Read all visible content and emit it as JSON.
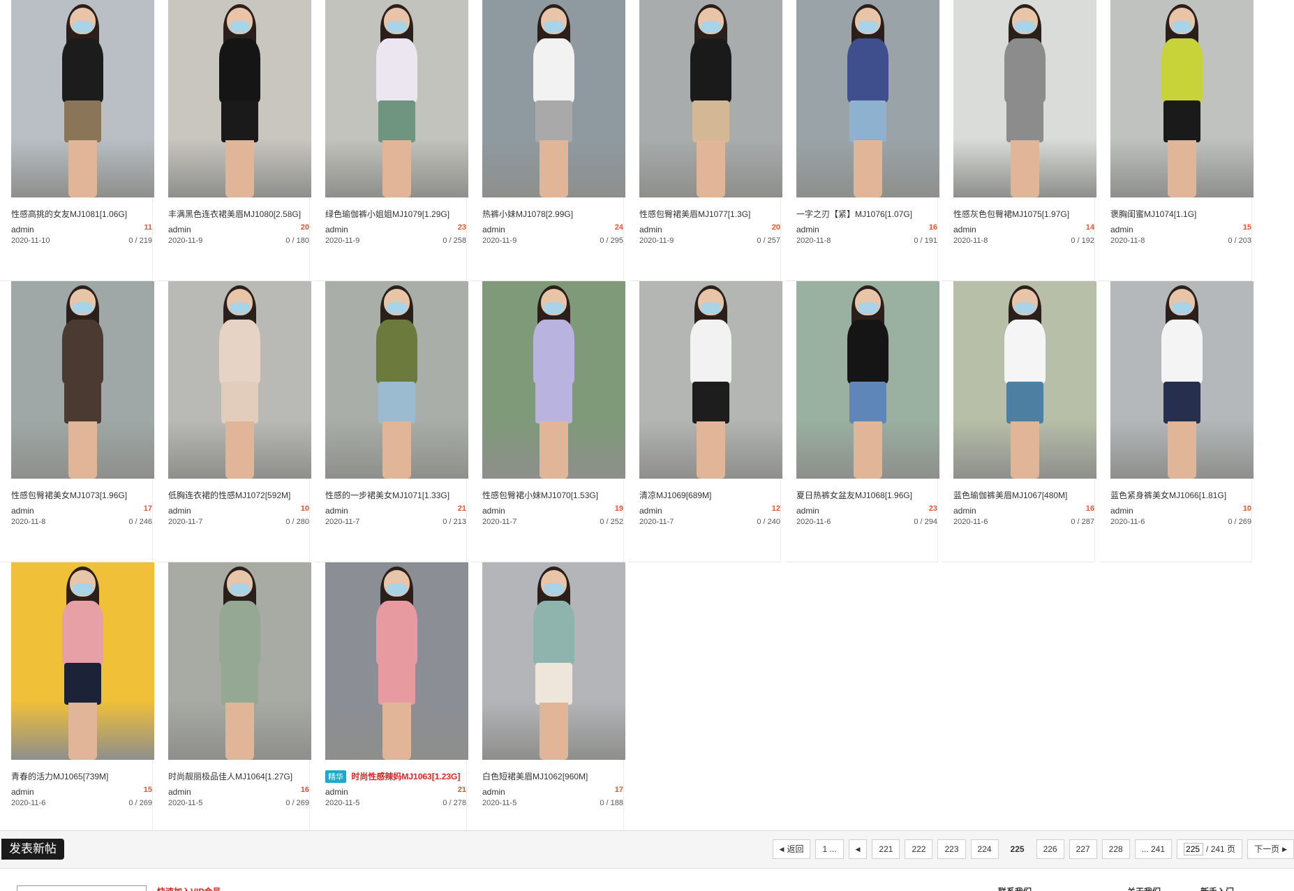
{
  "cards": [
    {
      "title": "性感高挑的女友MJ1081[1.06G]",
      "author": "admin",
      "count": "11",
      "date": "2020-11-10",
      "stats": "0 / 219",
      "bg": "#b9bfc4",
      "top": "#1c1c1c",
      "bottom": "#8a7558"
    },
    {
      "title": "丰满黑色连衣裙美眉MJ1080[2.58G]",
      "author": "admin",
      "count": "20",
      "date": "2020-11-9",
      "stats": "0 / 180",
      "bg": "#c9c6c0",
      "top": "#151515",
      "bottom": "#1a1a1a"
    },
    {
      "title": "绿色瑜伽裤小姐姐MJ1079[1.29G]",
      "author": "admin",
      "count": "23",
      "date": "2020-11-9",
      "stats": "0 / 258",
      "bg": "#c3c3bd",
      "top": "#ece6f0",
      "bottom": "#6f9480"
    },
    {
      "title": "热裤小妹MJ1078[2.99G]",
      "author": "admin",
      "count": "24",
      "date": "2020-11-9",
      "stats": "0 / 295",
      "bg": "#8f9aa0",
      "top": "#f2f2f2",
      "bottom": "#a9a9a9"
    },
    {
      "title": "性感包臀裙美眉MJ1077[1.3G]",
      "author": "admin",
      "count": "20",
      "date": "2020-11-9",
      "stats": "0 / 257",
      "bg": "#a8acac",
      "top": "#1a1a1a",
      "bottom": "#d4b896"
    },
    {
      "title": "一字之刃【紧】MJ1076[1.07G]",
      "author": "admin",
      "count": "16",
      "date": "2020-11-8",
      "stats": "0 / 191",
      "bg": "#9aa4a8",
      "top": "#3f4e8c",
      "bottom": "#8fb1d0"
    },
    {
      "title": "性感灰色包臀裙MJ1075[1.97G]",
      "author": "admin",
      "count": "14",
      "date": "2020-11-8",
      "stats": "0 / 192",
      "bg": "#d9dcd8",
      "top": "#8c8c8c",
      "bottom": "#8c8c8c"
    },
    {
      "title": "褒胸闺蜜MJ1074[1.1G]",
      "author": "admin",
      "count": "15",
      "date": "2020-11-8",
      "stats": "0 / 203",
      "bg": "#bfc2bf",
      "top": "#c8d33a",
      "bottom": "#1a1a1a"
    },
    {
      "title": "性感包臀裙美女MJ1073[1.96G]",
      "author": "admin",
      "count": "17",
      "date": "2020-11-8",
      "stats": "0 / 246",
      "bg": "#9fa8a6",
      "top": "#4a3a32",
      "bottom": "#4a3a32"
    },
    {
      "title": "低胸连衣裙的性感MJ1072[592M]",
      "author": "admin",
      "count": "10",
      "date": "2020-11-7",
      "stats": "0 / 280",
      "bg": "#b9bab5",
      "top": "#e6d3c5",
      "bottom": "#e2cdbd"
    },
    {
      "title": "性感的一步裙美女MJ1071[1.33G]",
      "author": "admin",
      "count": "21",
      "date": "2020-11-7",
      "stats": "0 / 213",
      "bg": "#a9aea8",
      "top": "#6d7a3e",
      "bottom": "#9bbcd0"
    },
    {
      "title": "性感包臀裙小妹MJ1070[1.53G]",
      "author": "admin",
      "count": "19",
      "date": "2020-11-7",
      "stats": "0 / 252",
      "bg": "#7e9a78",
      "top": "#b8b3df",
      "bottom": "#b8b3df"
    },
    {
      "title": "清凉MJ1069[689M]",
      "author": "admin",
      "count": "12",
      "date": "2020-11-7",
      "stats": "0 / 240",
      "bg": "#b4b6b4",
      "top": "#f2f2f2",
      "bottom": "#1d1d1d"
    },
    {
      "title": "夏日热裤女盆友MJ1068[1.96G]",
      "author": "admin",
      "count": "23",
      "date": "2020-11-6",
      "stats": "0 / 294",
      "bg": "#9ab0a0",
      "top": "#151515",
      "bottom": "#5f86b8"
    },
    {
      "title": "蓝色瑜伽裤美眉MJ1067[480M]",
      "author": "admin",
      "count": "16",
      "date": "2020-11-6",
      "stats": "0 / 287",
      "bg": "#b7bfa8",
      "top": "#f5f5f5",
      "bottom": "#4d7fa3"
    },
    {
      "title": "蓝色紧身裤美女MJ1066[1.81G]",
      "author": "admin",
      "count": "10",
      "date": "2020-11-6",
      "stats": "0 / 269",
      "bg": "#b4b8ba",
      "top": "#f4f4f4",
      "bottom": "#262f4d"
    },
    {
      "title": "青春的活力MJ1065[739M]",
      "author": "admin",
      "count": "15",
      "date": "2020-11-6",
      "stats": "0 / 269",
      "bg": "#f0c038",
      "top": "#e6a0a6",
      "bottom": "#1c2238"
    },
    {
      "title": "时尚靓丽极品佳人MJ1064[1.27G]",
      "author": "admin",
      "count": "16",
      "date": "2020-11-5",
      "stats": "0 / 269",
      "bg": "#a8aaa4",
      "top": "#94a894",
      "bottom": "#94a894"
    },
    {
      "title": "时尚性感辣妈MJ1063[1.23G]",
      "tag": "精华",
      "highlight": true,
      "author": "admin",
      "count": "21",
      "date": "2020-11-5",
      "stats": "0 / 278",
      "bg": "#8b8e94",
      "top": "#e79aa0",
      "bottom": "#e79aa0"
    },
    {
      "title": "白色短裙美眉MJ1062[960M]",
      "author": "admin",
      "count": "17",
      "date": "2020-11-5",
      "stats": "0 / 188",
      "bg": "#b3b5b8",
      "top": "#8fb4ae",
      "bottom": "#eee6da"
    }
  ],
  "post_button": "发表新帖",
  "pager": {
    "back": "返回",
    "first": "1 ...",
    "pages": [
      "221",
      "222",
      "223",
      "224",
      "225",
      "226",
      "227",
      "228"
    ],
    "current": "225",
    "last": "... 241",
    "jump_value": "225",
    "total": "/ 241 页",
    "next": "下一页"
  },
  "footer": {
    "red_text": "快速加入VIP会员",
    "col1": "联系我们",
    "col2": "关于我们",
    "col3": "新手入门"
  }
}
